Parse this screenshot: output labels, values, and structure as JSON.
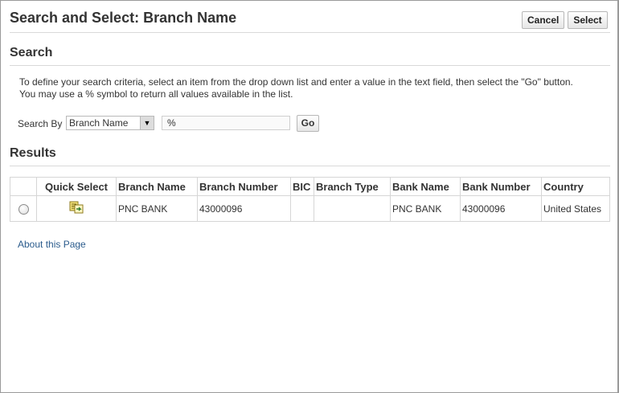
{
  "header": {
    "title": "Search and Select: Branch Name",
    "cancel_label": "Cancel",
    "select_label": "Select"
  },
  "search": {
    "section_title": "Search",
    "instructions_line1": "To define your search criteria, select an item from the drop down list and enter a value in the text field, then select the \"Go\" button.",
    "instructions_line2": "You may use a % symbol to return all values available in the list.",
    "search_by_label": "Search By",
    "search_by_value": "Branch Name",
    "query_value": "%",
    "go_label": "Go"
  },
  "results": {
    "section_title": "Results",
    "columns": [
      "Quick Select",
      "Branch Name",
      "Branch Number",
      "BIC",
      "Branch Type",
      "Bank Name",
      "Bank Number",
      "Country"
    ],
    "rows": [
      {
        "selected": false,
        "quick_select_icon": "quick-select-icon",
        "branch_name": "PNC BANK",
        "branch_number": "43000096",
        "bic": "",
        "branch_type": "",
        "bank_name": "PNC BANK",
        "bank_number": "43000096",
        "country": "United States"
      }
    ]
  },
  "footer": {
    "about_link": "About this Page"
  }
}
